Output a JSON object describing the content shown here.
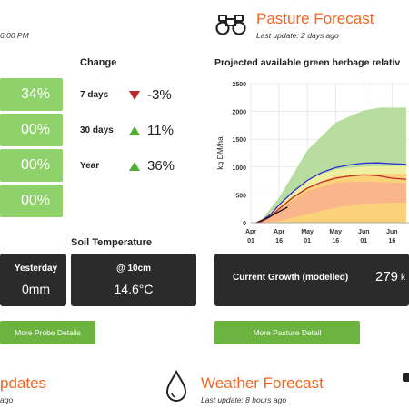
{
  "probe": {
    "timestamp": "6:00 PM",
    "change_heading": "Change",
    "moisture_values": [
      "34%",
      "00%",
      "00%",
      "00%"
    ],
    "changes": [
      {
        "label": "7 days",
        "value": "-3%",
        "direction": "down",
        "color": "#c0272d"
      },
      {
        "label": "30 days",
        "value": "11%",
        "direction": "up",
        "color": "#4caf2f"
      },
      {
        "label": "Year",
        "value": "36%",
        "direction": "up",
        "color": "#4caf2f"
      }
    ],
    "soil_temp_heading": "Soil Temperature",
    "rain_label": "Yesterday",
    "rain_value": "0mm",
    "temp_label": "@ 10cm",
    "temp_value": "14.6°C",
    "more_button": "More Probe Details"
  },
  "pasture": {
    "title": "Pasture Forecast",
    "last_update": "Last update: 2 days ago",
    "chart_title": "Projected available green herbage relativ",
    "current_growth_label": "Current Growth (modelled)",
    "current_growth_value": "279",
    "current_growth_unit": "k",
    "more_button": "More Pasture Detail"
  },
  "updates": {
    "title": "pdates",
    "last_update": "ago"
  },
  "weather": {
    "title": "Weather Forecast",
    "last_update": "Last update: 8 hours ago"
  },
  "icons": {
    "pasture": "binoculars-icon",
    "weather": "water-drop-icon"
  },
  "colors": {
    "accent_orange": "#f26522",
    "cell_green": "#8fd16a",
    "button_green": "#6cb33f",
    "dark_panel": "#2b2b2b"
  },
  "chart_data": {
    "type": "area",
    "title": "Projected available green herbage relativ",
    "ylabel": "kg DM/ha",
    "xlabel": "",
    "ylim": [
      0,
      2500
    ],
    "yticks": [
      "0",
      "500",
      "1000",
      "1500",
      "2000",
      "2500"
    ],
    "xticks": [
      {
        "x": 0,
        "top": "Apr",
        "bottom": "01"
      },
      {
        "x": 1,
        "top": "Apr",
        "bottom": "16"
      },
      {
        "x": 2,
        "top": "May",
        "bottom": "01"
      },
      {
        "x": 3,
        "top": "May",
        "bottom": "16"
      },
      {
        "x": 4,
        "top": "Jun",
        "bottom": "01"
      },
      {
        "x": 5,
        "top": "Jun",
        "bottom": "16"
      }
    ],
    "grid": true,
    "bands": [
      {
        "color": "#b9dca0",
        "upper": [
          [
            0.3,
            0
          ],
          [
            1,
            450
          ],
          [
            2,
            1300
          ],
          [
            3,
            1800
          ],
          [
            4,
            2020
          ],
          [
            4.6,
            2070
          ],
          [
            5.5,
            2070
          ]
        ],
        "lower": [
          [
            0.3,
            0
          ],
          [
            5.5,
            0
          ]
        ]
      },
      {
        "color": "#eef0a0",
        "upper": [
          [
            0.3,
            0
          ],
          [
            1,
            330
          ],
          [
            2,
            780
          ],
          [
            3,
            960
          ],
          [
            4,
            1010
          ],
          [
            5,
            1020
          ],
          [
            5.5,
            1020
          ]
        ],
        "lower": [
          [
            0.3,
            0
          ],
          [
            5.5,
            0
          ]
        ]
      },
      {
        "color": "#fbd27a",
        "upper": [
          [
            0.3,
            0
          ],
          [
            1,
            290
          ],
          [
            2,
            640
          ],
          [
            3,
            840
          ],
          [
            4,
            880
          ],
          [
            5,
            880
          ],
          [
            5.5,
            880
          ]
        ],
        "lower": [
          [
            0.3,
            0
          ],
          [
            5.5,
            0
          ]
        ]
      },
      {
        "color": "#fbb58a",
        "upper": [
          [
            0.3,
            0
          ],
          [
            1,
            240
          ],
          [
            2,
            560
          ],
          [
            3,
            720
          ],
          [
            4,
            740
          ],
          [
            5,
            720
          ],
          [
            5.5,
            710
          ]
        ],
        "lower": [
          [
            0.3,
            0
          ],
          [
            1,
            30
          ],
          [
            2,
            150
          ],
          [
            3,
            270
          ],
          [
            4,
            340
          ],
          [
            5,
            360
          ],
          [
            5.5,
            360
          ]
        ]
      }
    ],
    "series": [
      {
        "color": "#2b2bd6",
        "points": [
          [
            0.3,
            0
          ],
          [
            0.7,
            150
          ],
          [
            1,
            320
          ],
          [
            1.5,
            560
          ],
          [
            2,
            760
          ],
          [
            2.5,
            900
          ],
          [
            3,
            990
          ],
          [
            3.5,
            1040
          ],
          [
            4,
            1070
          ],
          [
            4.5,
            1075
          ],
          [
            5,
            1060
          ],
          [
            5.5,
            1050
          ]
        ]
      },
      {
        "color": "#c0272d",
        "points": [
          [
            0.3,
            0
          ],
          [
            0.7,
            110
          ],
          [
            1,
            250
          ],
          [
            1.5,
            460
          ],
          [
            2,
            620
          ],
          [
            2.5,
            730
          ],
          [
            3,
            800
          ],
          [
            3.5,
            840
          ],
          [
            4,
            860
          ],
          [
            4.5,
            845
          ],
          [
            5,
            800
          ],
          [
            5.5,
            780
          ]
        ]
      },
      {
        "color": "#111111",
        "points": [
          [
            0.2,
            0
          ],
          [
            0.6,
            90
          ],
          [
            1,
            200
          ],
          [
            1.3,
            280
          ]
        ]
      }
    ]
  }
}
